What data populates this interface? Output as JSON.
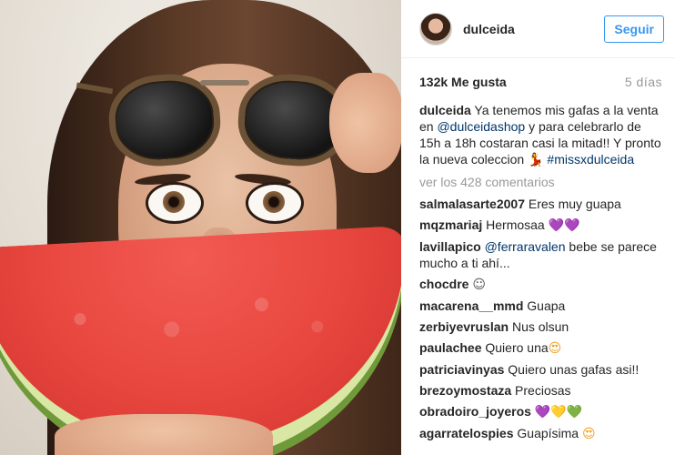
{
  "post": {
    "username": "dulceida",
    "follow_label": "Seguir",
    "likes": "132k Me gusta",
    "time": "5 días"
  },
  "caption": {
    "username": "dulceida",
    "text_1": " Ya tenemos mis gafas a la venta en ",
    "mention": "@dulceidashop",
    "text_2": " y para celebrarlo de 15h a 18h costaran casi la mitad!! Y pronto la nueva coleccion ",
    "emoji": "💃",
    "hashtag": "#missxdulceida"
  },
  "load_more": "ver los 428 comentarios",
  "comments": [
    {
      "user": "salmalasarte2007",
      "text": " Eres muy guapa",
      "emoji": "",
      "emoji_color": ""
    },
    {
      "user": "mqzmariaj",
      "text": " Hermosaa",
      "emoji": "💜💜",
      "emoji_color": "#a64dff"
    },
    {
      "user": "lavillapico",
      "text": "",
      "mention": "@ferraravalen",
      "text_after": " bebe se parece mucho a ti ahí...",
      "emoji": "",
      "emoji_color": ""
    },
    {
      "user": "chocdre",
      "text": " ",
      "emoji": "☺",
      "emoji_color": "#555555"
    },
    {
      "user": "macarena__mmd",
      "text": " Guapa",
      "emoji": "",
      "emoji_color": ""
    },
    {
      "user": "zerbiyevruslan",
      "text": " Nus olsun",
      "emoji": "",
      "emoji_color": ""
    },
    {
      "user": "paulachee",
      "text": " Quiero una",
      "emoji": "😍",
      "emoji_color": "#f0a020"
    },
    {
      "user": "patriciavinyas",
      "text": " Quiero unas gafas asi!!",
      "emoji": "",
      "emoji_color": ""
    },
    {
      "user": "brezoymostaza",
      "text": " Preciosas",
      "emoji": "",
      "emoji_color": ""
    },
    {
      "user": "obradoiro_joyeros",
      "text": " ",
      "emoji": "💜💛💚",
      "emoji_color": ""
    },
    {
      "user": "agarratelospies",
      "text": " Guapísima ",
      "emoji": "😍",
      "emoji_color": "#f0a020"
    }
  ],
  "colors": {
    "link": "#003569",
    "follow_button": "#3897f0",
    "muted": "#999999"
  }
}
